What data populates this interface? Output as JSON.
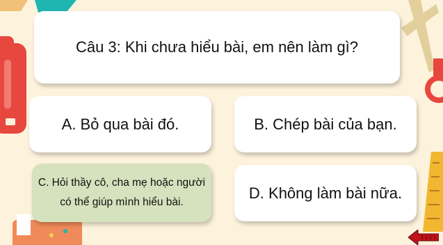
{
  "question": {
    "text": "Câu 3: Khi chưa hiểu bài, em nên làm gì?"
  },
  "answers": [
    {
      "label": "A. Bỏ qua bài đó."
    },
    {
      "label": "B. Chép bài của bạn."
    },
    {
      "label": "C. Hỏi thầy cô, cha mẹ hoặc người có thể giúp mình hiểu bài.",
      "highlight_color": "#d6e2bd"
    },
    {
      "label": "D. Không làm bài nữa."
    }
  ],
  "nav": {
    "back_icon": "back-arrow-icon"
  },
  "colors": {
    "background": "#fdf3dc",
    "card": "#ffffff",
    "highlight": "#d6e2bd",
    "accent_red": "#e8473f",
    "accent_teal": "#1fb5b0"
  }
}
